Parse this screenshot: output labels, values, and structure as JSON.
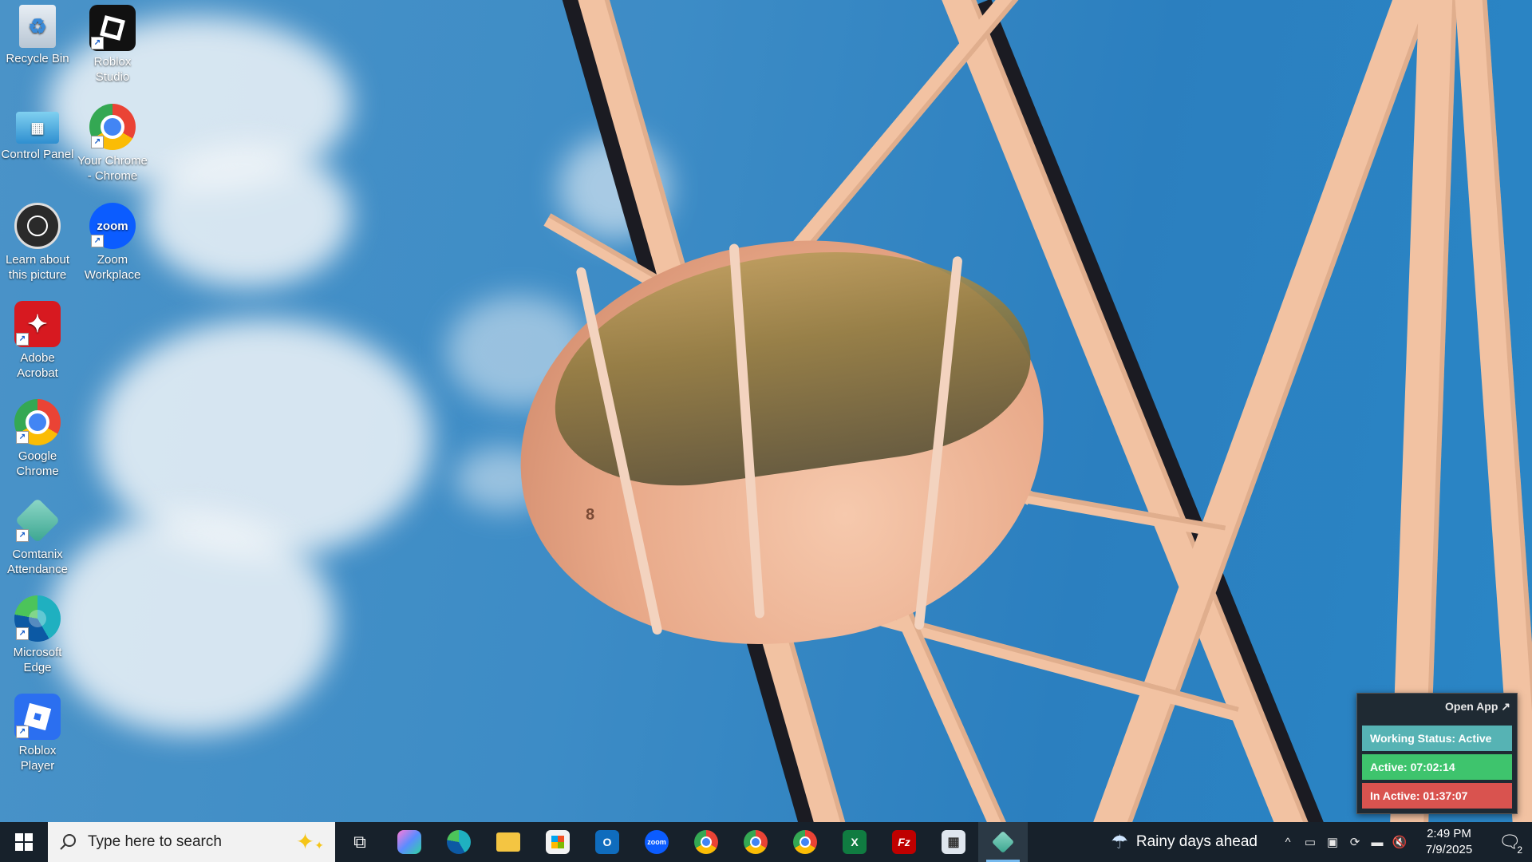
{
  "desktop": {
    "icons": [
      {
        "label": "Recycle Bin"
      },
      {
        "label": "Roblox Studio"
      },
      {
        "label": "Control Panel"
      },
      {
        "label": "Your Chrome - Chrome"
      },
      {
        "label": "Learn about this picture"
      },
      {
        "label": "Zoom Workplace"
      },
      {
        "label": "Adobe Acrobat"
      },
      {
        "label": "Google Chrome"
      },
      {
        "label": "Comtanix Attendance"
      },
      {
        "label": "Microsoft Edge"
      },
      {
        "label": "Roblox Player"
      }
    ],
    "zoom_icon_text": "zoom"
  },
  "widget": {
    "open_label": "Open App ↗",
    "status": "Working Status: Active",
    "active": "Active: 07:02:14",
    "inactive": "In Active: 01:37:07",
    "colors": {
      "status": "#56b3b4",
      "active": "#3ec46d",
      "inactive": "#d9534f"
    }
  },
  "gondola_number": "8",
  "taskbar": {
    "search_placeholder": "Type here to search",
    "apps": [
      "task-view",
      "copilot",
      "edge",
      "file-explorer",
      "microsoft-store",
      "outlook",
      "zoom",
      "chrome",
      "chrome",
      "chrome",
      "excel",
      "filezilla",
      "calculator",
      "comtanix-attendance"
    ],
    "weather": "Rainy days ahead",
    "time": "2:49 PM",
    "date": "7/9/2025",
    "notification_count": "2"
  }
}
